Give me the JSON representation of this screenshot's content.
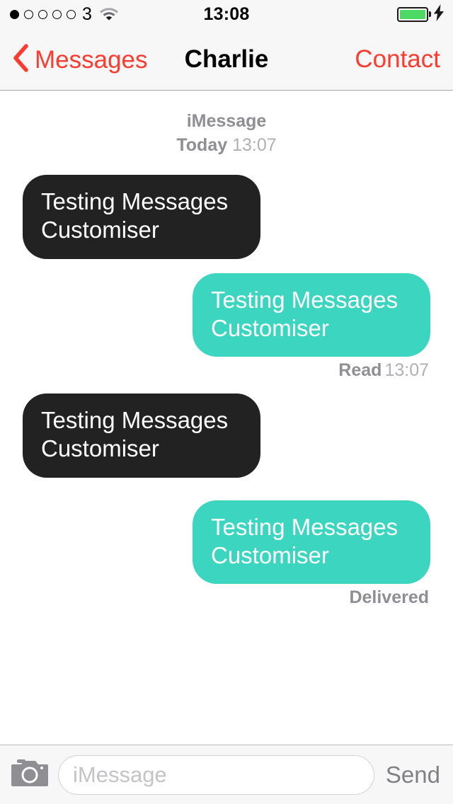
{
  "status_bar": {
    "signal_dots_total": 5,
    "signal_dots_filled": 1,
    "carrier": "3",
    "wifi_icon": "wifi-icon",
    "time": "13:08",
    "battery_icon": "battery-full-icon",
    "battery_level_percent": 100,
    "battery_color": "#4cd964",
    "charging_icon": "lightning-bolt-icon"
  },
  "nav_bar": {
    "back_icon": "chevron-left-icon",
    "back_label": "Messages",
    "title": "Charlie",
    "right_action": "Contact",
    "accent_color": "#ff3b30"
  },
  "conversation": {
    "day_header": {
      "service": "iMessage",
      "day": "Today",
      "time": "13:07"
    },
    "messages": [
      {
        "id": 1,
        "direction": "incoming",
        "text": "Testing Messages Customiser",
        "bubble_color": "#222222",
        "text_color": "#ffffff",
        "receipt_status": "",
        "receipt_time": ""
      },
      {
        "id": 2,
        "direction": "outgoing",
        "text": "Testing Messages Customiser",
        "bubble_color": "#3cd6c0",
        "text_color": "#ffffff",
        "receipt_status": "Read",
        "receipt_time": "13:07"
      },
      {
        "id": 3,
        "direction": "incoming",
        "text": "Testing Messages Customiser",
        "bubble_color": "#222222",
        "text_color": "#ffffff",
        "receipt_status": "",
        "receipt_time": ""
      },
      {
        "id": 4,
        "direction": "outgoing",
        "text": "Testing Messages Customiser",
        "bubble_color": "#3cd6c0",
        "text_color": "#ffffff",
        "receipt_status": "Delivered",
        "receipt_time": ""
      }
    ]
  },
  "toolbar": {
    "camera_icon": "camera-icon",
    "input_value": "",
    "input_placeholder": "iMessage",
    "send_label": "Send"
  }
}
